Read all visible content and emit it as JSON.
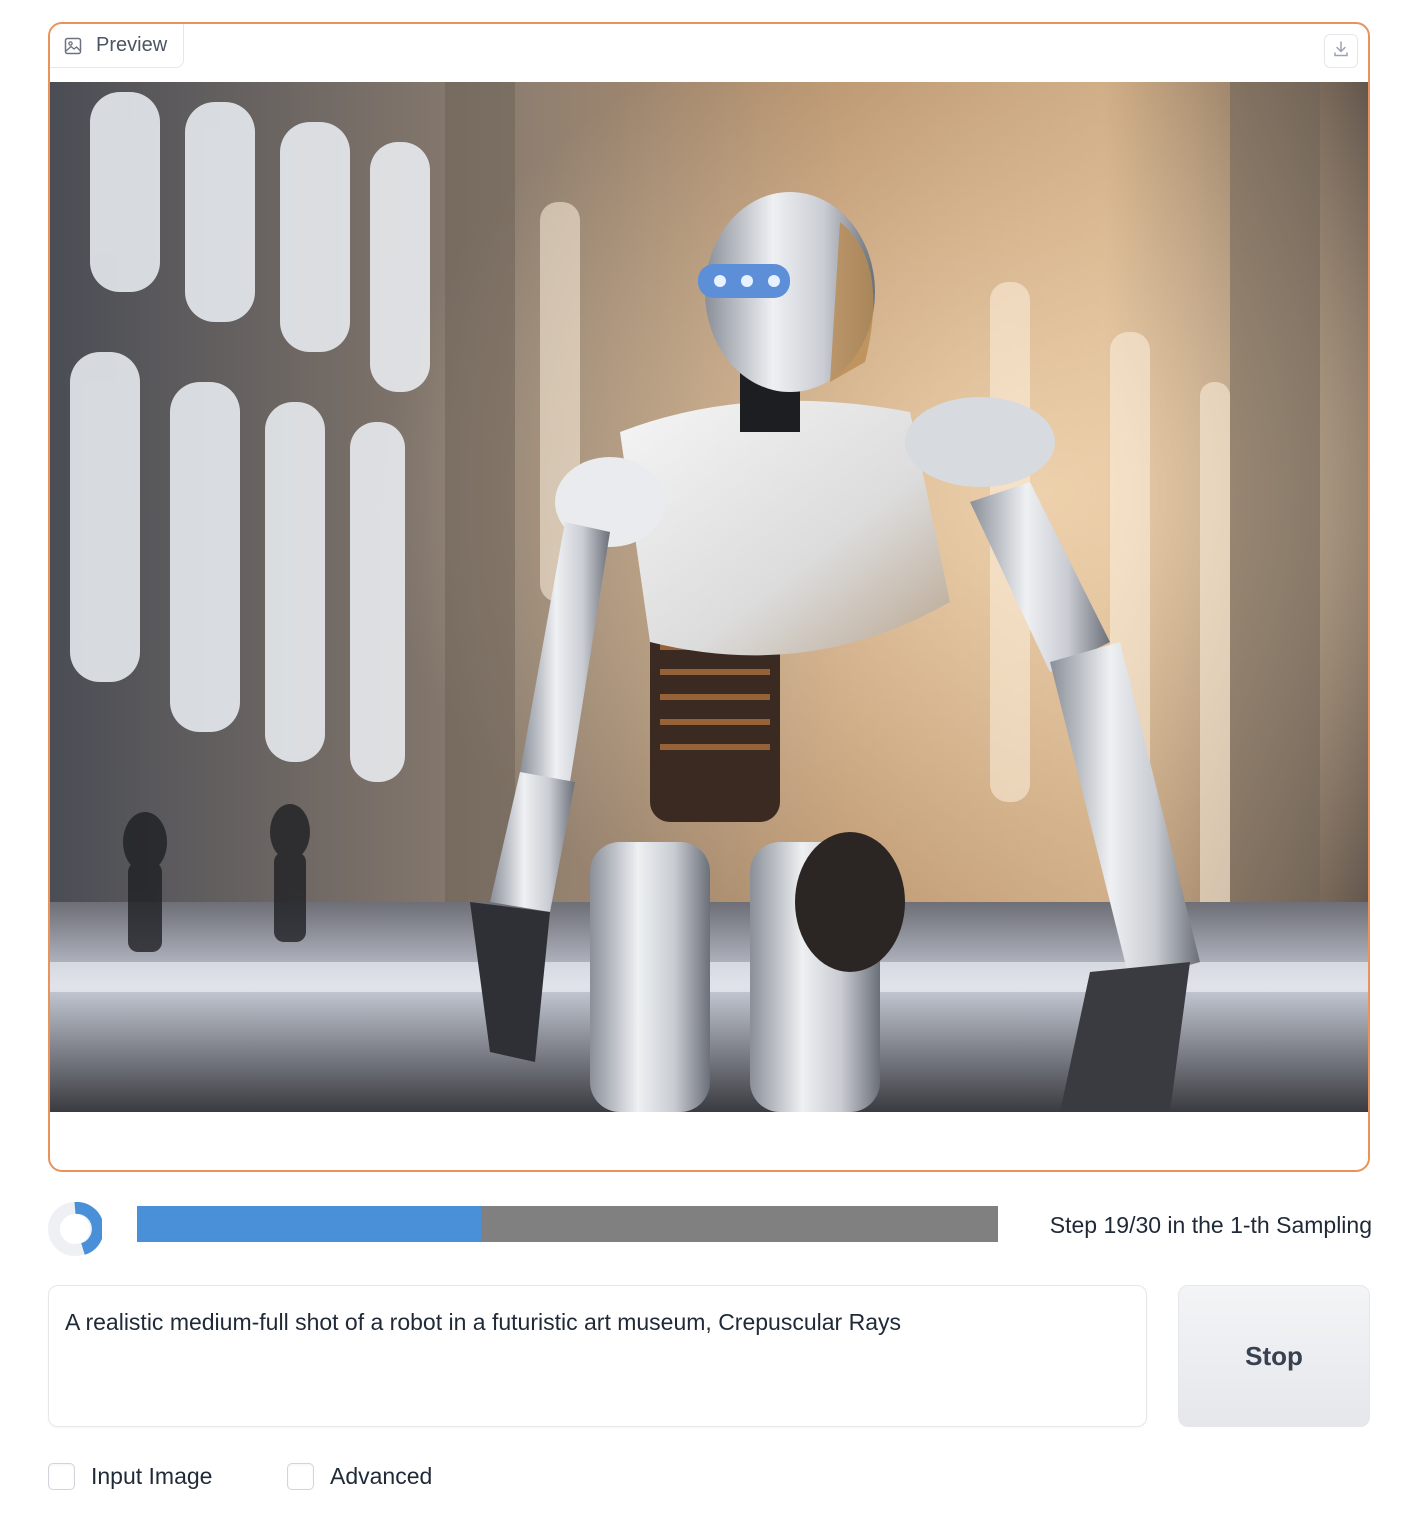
{
  "preview": {
    "label": "Preview",
    "label_icon": "image-icon",
    "download_icon": "download-icon",
    "image_description_icon": "generated-image"
  },
  "progress": {
    "current_step": 19,
    "total_steps": 30,
    "fraction": 0.4,
    "text": "Step 19/30 in the 1-th Sampling",
    "bar_fill_color": "#4a90d9",
    "bar_track_color": "#808080"
  },
  "prompt": {
    "value": "A realistic medium-full shot of a robot in a futuristic art museum, Crepuscular Rays"
  },
  "stop_button": {
    "label": "Stop"
  },
  "options": {
    "input_image": {
      "label": "Input Image",
      "checked": false
    },
    "advanced": {
      "label": "Advanced",
      "checked": false
    }
  },
  "colors": {
    "panel_border": "#e8935a"
  }
}
